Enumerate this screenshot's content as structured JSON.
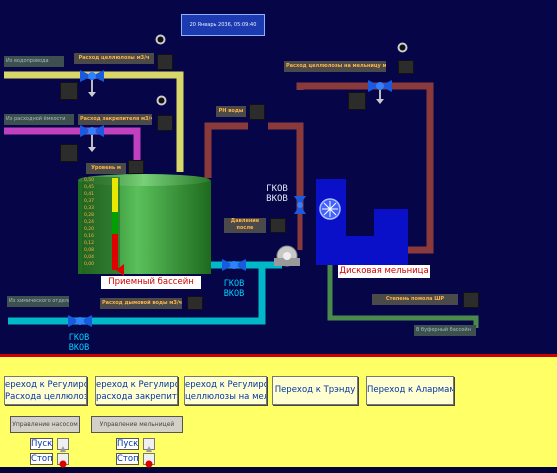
{
  "datetime": "20 Январь 2036, 05:09:40",
  "sources": {
    "water": "Из водопровода",
    "filler": "Из расходной ёмкости",
    "chemical": "Из химического отдела",
    "buffer": "В буферный бассейн"
  },
  "labels": {
    "flow_cellulose": "Расход целлюлозы м3/ч",
    "flow_additive": "Расход закрепителя м3/ч",
    "level": "Уровень м",
    "ph": "PН воды",
    "pressure_after_pump": "Давление после насоса",
    "cellulose_to_mill": "Расход целлюлозы на мельницу м3/ч",
    "flow_water": "Расход дымовой воды м3/ч",
    "grinding": "Степень помола ШР"
  },
  "tank": {
    "title": "Приемный бассейн",
    "scale": [
      "0,50",
      "0,45",
      "0,41",
      "0,37",
      "0,33",
      "0,28",
      "0,24",
      "0,20",
      "0,16",
      "0,12",
      "0,08",
      "0,04",
      "0,00"
    ]
  },
  "mill": {
    "title": "Дисковая мельница"
  },
  "pump_indicators": {
    "p1": [
      "ГКОВ",
      "ВКОВ"
    ],
    "p2": [
      "ГКОВ",
      "ВКОВ"
    ],
    "p3": [
      "ГКОВ",
      "ВКОВ"
    ],
    "p4": [
      "ГКОВ",
      "ВКОВ"
    ]
  },
  "nav": [
    {
      "line1": "ереход к  Регулирова",
      "line2": "Расхода целлюлозы"
    },
    {
      "line1": "ереход к  Регулирова",
      "line2": "расхода закрепителя"
    },
    {
      "line1": "ереход к  Регулирова",
      "line2": "целлюлозы на мельни"
    },
    {
      "line1": "Переход к  Трэнду",
      "line2": ""
    },
    {
      "line1": "Переход к  Алармам",
      "line2": ""
    }
  ],
  "control": {
    "pumps": "Управление  насосом",
    "mill": "Управление  мельницей",
    "start": "Пуск",
    "stop": "Стоп"
  },
  "colors": {
    "pipe_yellow": "#d8d86a",
    "pipe_magenta": "#c040c0",
    "pipe_brown": "#8a3a3a",
    "pipe_cyan": "#00b8c8",
    "pipe_green": "#4a8a4a",
    "tank_green": "#3a9a3a",
    "mill_blue": "#0a10c8",
    "panel_yellow": "#ffff66"
  }
}
